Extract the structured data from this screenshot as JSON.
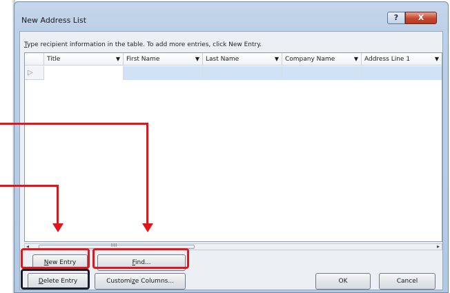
{
  "window": {
    "title": "New Address List",
    "help_label": "?",
    "close_label": "X"
  },
  "instructions": {
    "mnemonic": "T",
    "text": "ype recipient information in the table.  To add more entries, click New Entry."
  },
  "table": {
    "columns": [
      {
        "label": "Title",
        "arrow": "▼"
      },
      {
        "label": "First Name",
        "arrow": "▼"
      },
      {
        "label": "Last Name",
        "arrow": "▼"
      },
      {
        "label": "Company Name",
        "arrow": "▼"
      },
      {
        "label": "Address Line 1",
        "arrow": "▼"
      }
    ],
    "new_row_marker": "▷"
  },
  "scrollbar": {
    "left_arrow": "◂",
    "right_arrow": "▸",
    "grip": "III"
  },
  "buttons": {
    "new_entry": {
      "mnemonic": "N",
      "rest": "ew Entry"
    },
    "find": {
      "mnemonic": "F",
      "rest": "ind..."
    },
    "delete_entry": {
      "mnemonic": "D",
      "rest": "elete Entry"
    },
    "customize_columns": {
      "pre": "Customi",
      "mnemonic": "z",
      "rest": "e Columns..."
    },
    "ok": "OK",
    "cancel": "Cancel"
  },
  "colors": {
    "callout": "#e1151c",
    "selected_row": "#cfe2f6",
    "close_button": "#c7452c"
  }
}
